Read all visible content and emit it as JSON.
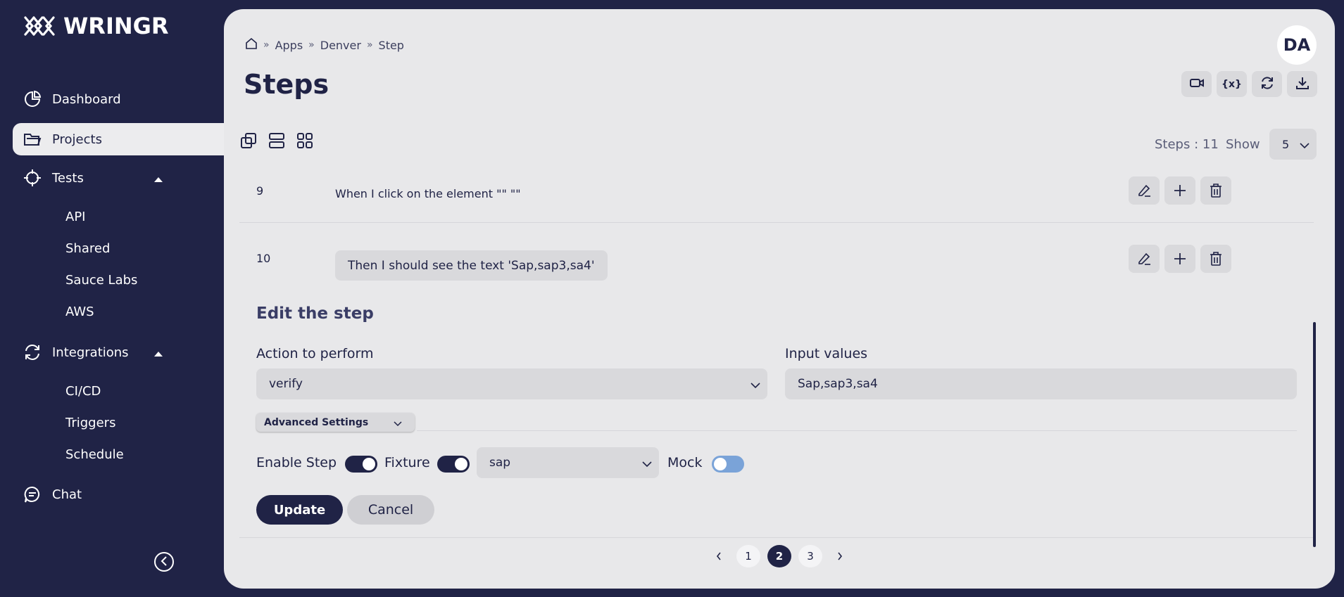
{
  "app": {
    "name": "WRINGR"
  },
  "sidebar": {
    "items": [
      {
        "label": "Dashboard",
        "icon": "pie-chart-icon"
      },
      {
        "label": "Projects",
        "icon": "folder-icon",
        "active": true
      },
      {
        "label": "Tests",
        "icon": "crosshair-icon",
        "expanded": true,
        "children": [
          "API",
          "Shared",
          "Sauce Labs",
          "AWS"
        ]
      },
      {
        "label": "Integrations",
        "icon": "refresh-icon",
        "expanded": true,
        "children": [
          "CI/CD",
          "Triggers",
          "Schedule"
        ]
      },
      {
        "label": "Chat",
        "icon": "chat-icon"
      }
    ]
  },
  "breadcrumb": [
    "Apps",
    "Denver",
    "Step"
  ],
  "page": {
    "title": "Steps"
  },
  "user": {
    "initials": "DA"
  },
  "toolbar": {
    "buttons": [
      "video-icon",
      "variable-icon",
      "refresh-icon",
      "download-icon"
    ]
  },
  "list_controls": {
    "steps_count": "Steps : 11",
    "show_label": "Show",
    "show_value": "5"
  },
  "steps": [
    {
      "number": "9",
      "text": "When I click on the element \"\" \"\""
    },
    {
      "number": "10",
      "text": "Then I should see the text 'Sap,sap3,sa4'"
    }
  ],
  "edit": {
    "title": "Edit the step",
    "action_label": "Action to perform",
    "action_value": "verify",
    "input_label": "Input values",
    "input_value": "Sap,sap3,sa4",
    "advanced_label": "Advanced Settings",
    "enable_step_label": "Enable Step",
    "enable_step_on": true,
    "fixture_label": "Fixture",
    "fixture_on": true,
    "fixture_value": "sap",
    "mock_label": "Mock",
    "mock_on": false,
    "update_label": "Update",
    "cancel_label": "Cancel"
  },
  "pagination": {
    "pages": [
      "1",
      "2",
      "3"
    ],
    "current": "2"
  },
  "colors": {
    "navy": "#202346",
    "panel": "#e8e8ea",
    "control": "#d9d9dc",
    "toggle_off": "#7aa3d8"
  }
}
